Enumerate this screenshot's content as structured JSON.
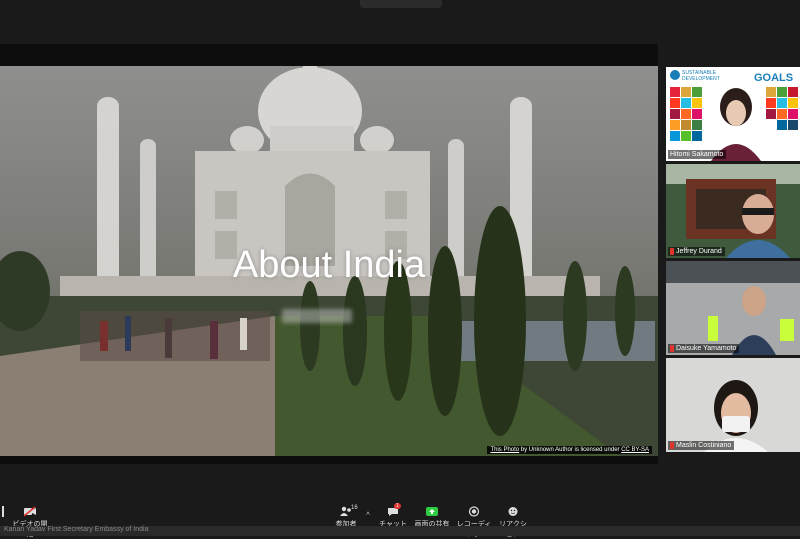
{
  "slide": {
    "title": "About India",
    "credit_prefix": "This Photo",
    "credit_mid": " by Unknown Author is licensed under ",
    "credit_license": "CC BY-SA"
  },
  "participants": [
    {
      "name": "Hitomi Sakamoto"
    },
    {
      "name": "Jeffrey Durand"
    },
    {
      "name": "Daisuke Yamamoto"
    },
    {
      "name": "Maslin Costiniano"
    }
  ],
  "sdg_banner": {
    "line1": "SUSTAINABLE",
    "line2": "DEVELOPMENT",
    "word": "GOALS"
  },
  "toolbar": {
    "video_label": "ビデオの開始",
    "participants_label": "参加者",
    "participants_count": "16",
    "chat_label": "チャット",
    "chat_badge": "1",
    "share_label": "画面の共有",
    "record_label": "レコーディング",
    "reaction_label": "リアクション"
  },
  "bottom_caption": "Kanan Yadav First Secretary Embassy of India",
  "colors": {
    "share_green": "#2ecc40",
    "badge_red": "#e0342c",
    "mic_red": "#e0342c"
  }
}
